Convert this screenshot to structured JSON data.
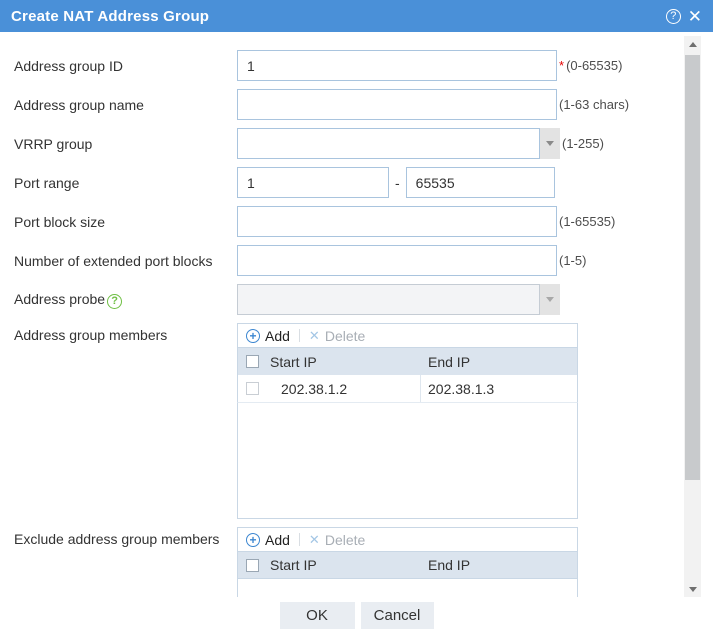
{
  "header": {
    "title": "Create NAT Address Group"
  },
  "icons": {
    "help": "?",
    "close": "✕",
    "add": "+",
    "delete": "✕",
    "probe_help": "?"
  },
  "form": {
    "address_group_id": {
      "label": "Address group ID",
      "value": "1",
      "required_mark": "*",
      "hint": "(0-65535)"
    },
    "address_group_name": {
      "label": "Address group name",
      "value": "",
      "hint": "(1-63 chars)"
    },
    "vrrp_group": {
      "label": "VRRP group",
      "value": "",
      "hint": "(1-255)"
    },
    "port_range": {
      "label": "Port range",
      "start": "1",
      "separator": "-",
      "end": "65535"
    },
    "port_block_size": {
      "label": "Port block size",
      "value": "",
      "hint": "(1-65535)"
    },
    "extended_port_blocks": {
      "label": "Number of extended port blocks",
      "value": "",
      "hint": "(1-5)"
    },
    "address_probe": {
      "label": "Address probe",
      "value": ""
    },
    "members": {
      "label": "Address group members",
      "add_label": "Add",
      "delete_label": "Delete",
      "columns": [
        "Start IP",
        "End IP"
      ],
      "rows": [
        {
          "start_ip": "202.38.1.2",
          "end_ip": "202.38.1.3"
        }
      ]
    },
    "exclude_members": {
      "label": "Exclude address group members",
      "add_label": "Add",
      "delete_label": "Delete",
      "columns": [
        "Start IP",
        "End IP"
      ],
      "rows": []
    }
  },
  "footer": {
    "ok_label": "OK",
    "cancel_label": "Cancel"
  },
  "colors": {
    "header_bg": "#4a90d8",
    "accent_blue": "#3d87d1",
    "table_header_bg": "#dbe4ee",
    "input_border": "#a9c4de",
    "help_green": "#6fbf44",
    "required_red": "#e60000"
  }
}
